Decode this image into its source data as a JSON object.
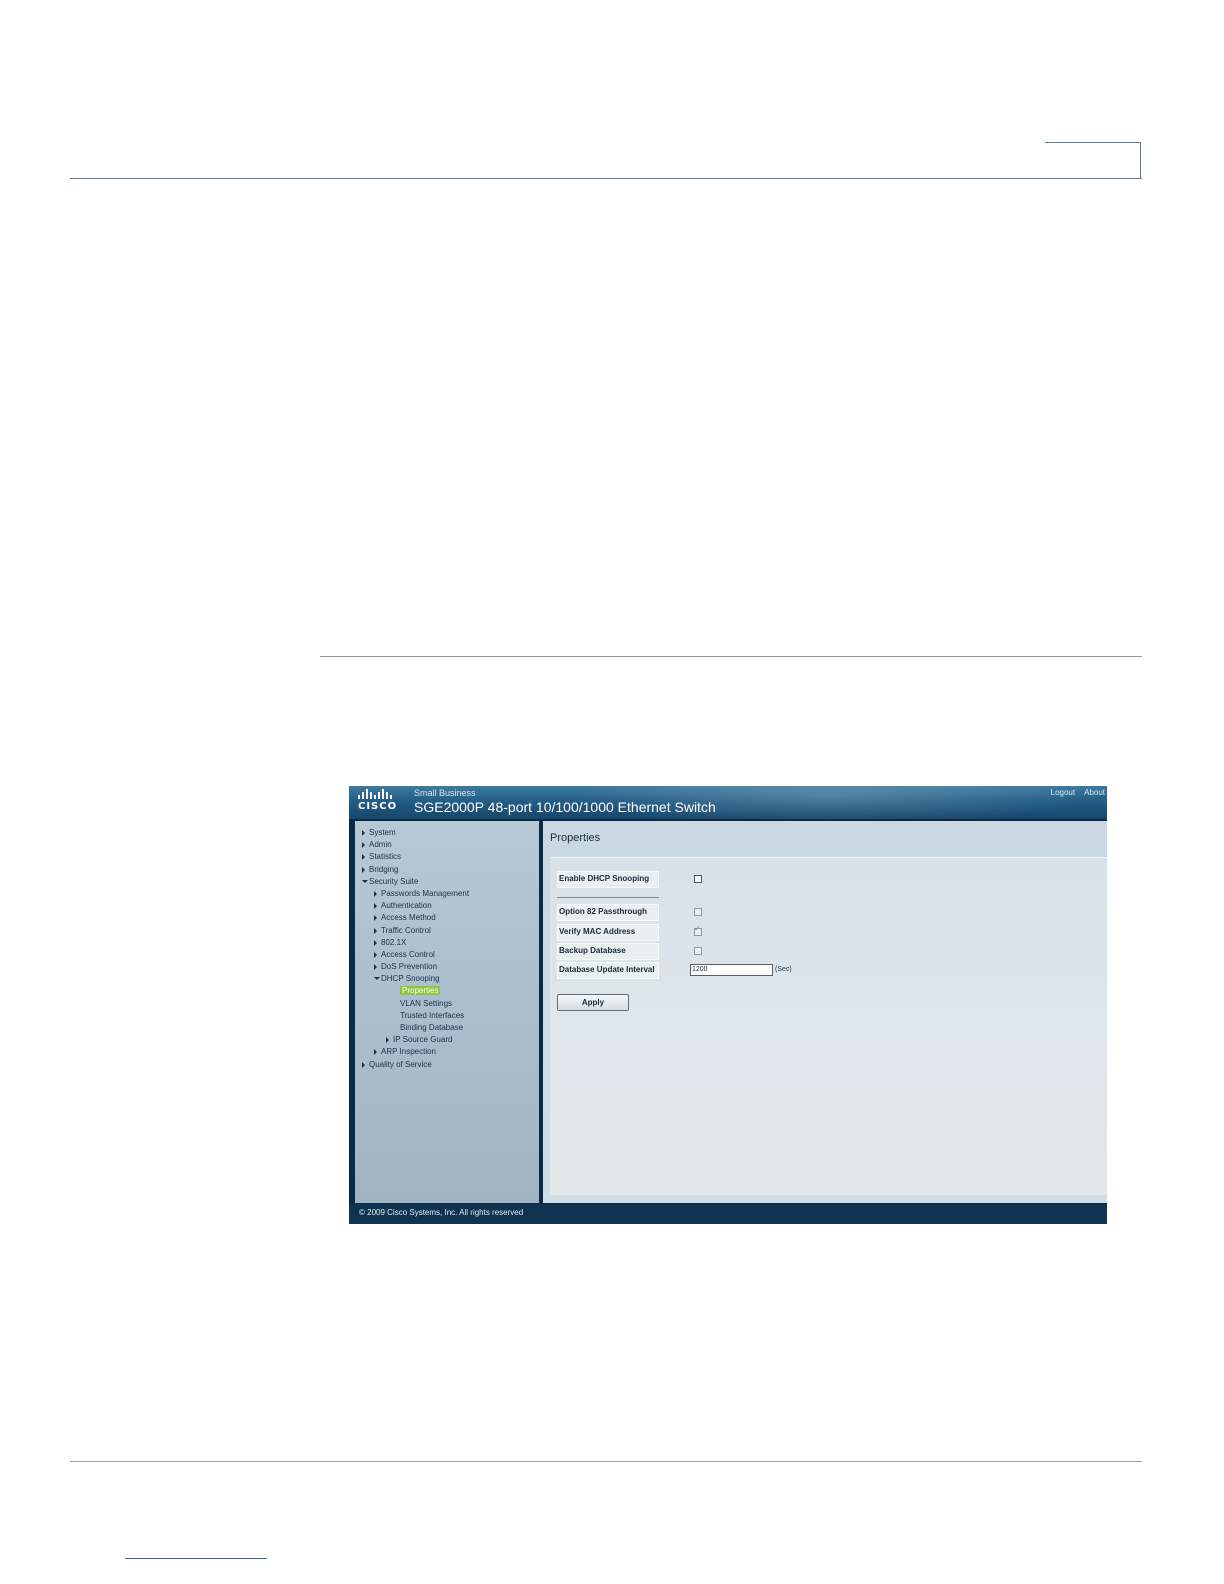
{
  "app": {
    "brand_sub": "Small Business",
    "logo_text": "CISCO",
    "product_title": "SGE2000P 48-port 10/100/1000 Ethernet Switch",
    "top_links": {
      "logout": "Logout",
      "about": "About"
    }
  },
  "nav": {
    "items": [
      {
        "label": "System",
        "level": 0,
        "arrow": "right"
      },
      {
        "label": "Admin",
        "level": 0,
        "arrow": "right"
      },
      {
        "label": "Statistics",
        "level": 0,
        "arrow": "right"
      },
      {
        "label": "Bridging",
        "level": 0,
        "arrow": "right"
      },
      {
        "label": "Security Suite",
        "level": 0,
        "arrow": "down"
      },
      {
        "label": "Passwords Management",
        "level": 1,
        "arrow": "right"
      },
      {
        "label": "Authentication",
        "level": 1,
        "arrow": "right"
      },
      {
        "label": "Access Method",
        "level": 1,
        "arrow": "right"
      },
      {
        "label": "Traffic Control",
        "level": 1,
        "arrow": "right"
      },
      {
        "label": "802.1X",
        "level": 1,
        "arrow": "right"
      },
      {
        "label": "Access Control",
        "level": 1,
        "arrow": "right"
      },
      {
        "label": "DoS Prevention",
        "level": 1,
        "arrow": "right"
      },
      {
        "label": "DHCP Snooping",
        "level": 1,
        "arrow": "down"
      },
      {
        "label": "Properties",
        "level": 3,
        "arrow": "none",
        "selected": true
      },
      {
        "label": "VLAN Settings",
        "level": 3,
        "arrow": "none"
      },
      {
        "label": "Trusted Interfaces",
        "level": 3,
        "arrow": "none"
      },
      {
        "label": "Binding Database",
        "level": 3,
        "arrow": "none"
      },
      {
        "label": "IP Source Guard",
        "level": 2,
        "arrow": "right"
      },
      {
        "label": "ARP Inspection",
        "level": 1,
        "arrow": "right"
      },
      {
        "label": "Quality of Service",
        "level": 0,
        "arrow": "right"
      }
    ]
  },
  "main": {
    "title": "Properties",
    "fields": {
      "enable_dhcp_snooping": {
        "label": "Enable DHCP Snooping",
        "checked": false
      },
      "option82": {
        "label": "Option 82 Passthrough",
        "checked": false
      },
      "verify_mac": {
        "label": "Verify MAC Address",
        "checked": true
      },
      "backup_db": {
        "label": "Backup Database",
        "checked": false
      },
      "update_interval": {
        "label": "Database Update Interval",
        "value": "1200",
        "unit": "(Sec)"
      }
    },
    "apply_label": "Apply"
  },
  "footer": {
    "copyright": "© 2009 Cisco Systems, Inc. All rights reserved"
  },
  "colors": {
    "banner": "#245d86",
    "selected_nav": "#8dc63f",
    "frame": "#0f3350"
  },
  "icons": {
    "nav_collapsed": "triangle-right-icon",
    "nav_expanded": "triangle-down-icon"
  }
}
